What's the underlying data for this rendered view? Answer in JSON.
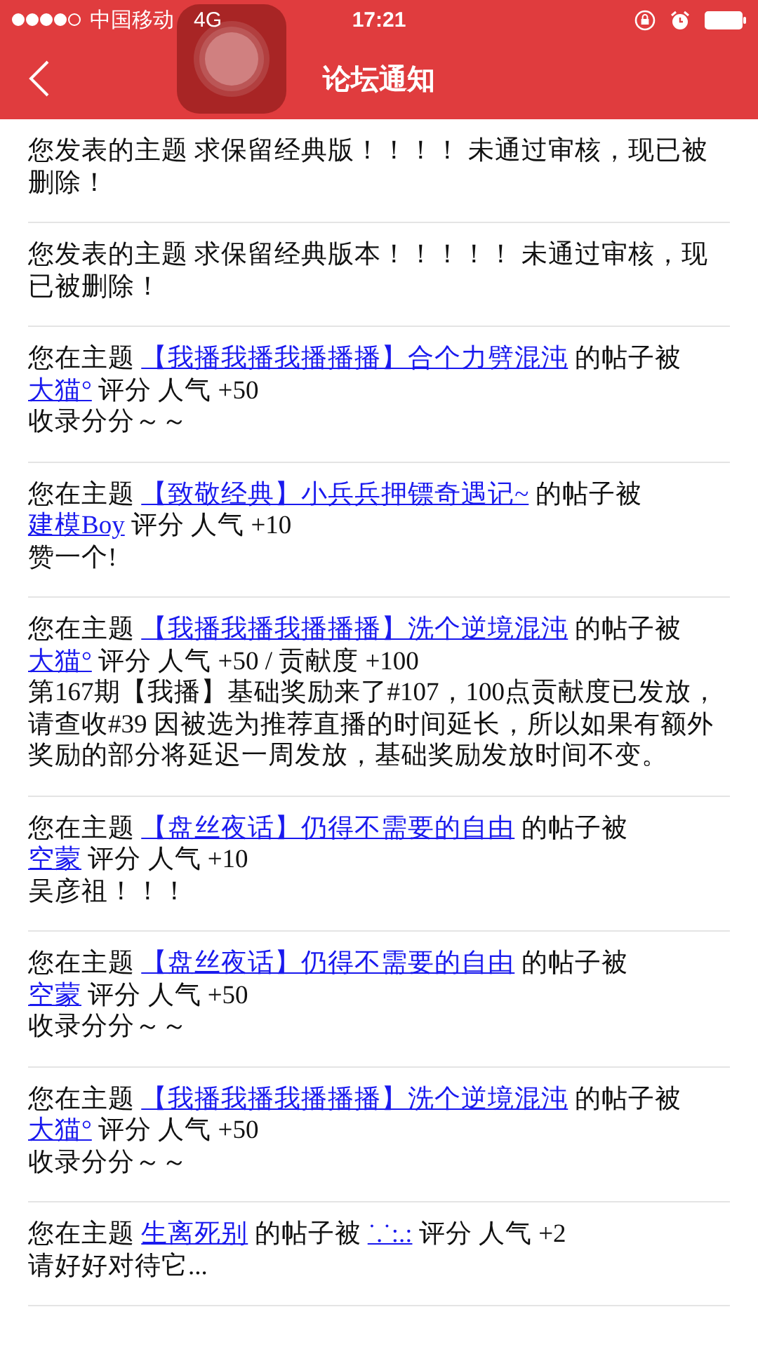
{
  "status_bar": {
    "carrier": "中国移动",
    "network": "4G",
    "time": "17:21"
  },
  "nav": {
    "title": "论坛通知"
  },
  "notices": [
    {
      "segments": [
        {
          "kind": "text",
          "text": "您发表的主题 求保留经典版！！！！ 未通过审核，现已被删除！"
        }
      ]
    },
    {
      "segments": [
        {
          "kind": "text",
          "text": "您发表的主题 求保留经典版本！！！！！ 未通过审核，现已被删除！"
        }
      ]
    },
    {
      "segments": [
        {
          "kind": "text",
          "text": "您在主题 "
        },
        {
          "kind": "link",
          "text": "【我播我播我播播播】合个力劈混沌"
        },
        {
          "kind": "text",
          "text": " 的帖子被 "
        },
        {
          "kind": "link",
          "text": "大猫°"
        },
        {
          "kind": "text",
          "text": " 评分 人气 +50"
        }
      ],
      "message": "收录分分～～"
    },
    {
      "segments": [
        {
          "kind": "text",
          "text": "您在主题 "
        },
        {
          "kind": "link",
          "text": "【致敬经典】小兵兵押镖奇遇记~"
        },
        {
          "kind": "text",
          "text": " 的帖子被 "
        },
        {
          "kind": "link",
          "text": "建模Boy"
        },
        {
          "kind": "text",
          "text": " 评分 人气 +10"
        }
      ],
      "message": "赞一个!"
    },
    {
      "segments": [
        {
          "kind": "text",
          "text": "您在主题 "
        },
        {
          "kind": "link",
          "text": "【我播我播我播播播】洗个逆境混沌"
        },
        {
          "kind": "text",
          "text": " 的帖子被 "
        },
        {
          "kind": "link",
          "text": "大猫°"
        },
        {
          "kind": "text",
          "text": " 评分 人气 +50 / 贡献度 +100"
        }
      ],
      "message": "第167期【我播】基础奖励来了#107，100点贡献度已发放，请查收#39 因被选为推荐直播的时间延长，所以如果有额外奖励的部分将延迟一周发放，基础奖励发放时间不变。"
    },
    {
      "segments": [
        {
          "kind": "text",
          "text": "您在主题 "
        },
        {
          "kind": "link",
          "text": "【盘丝夜话】仍得不需要的自由"
        },
        {
          "kind": "text",
          "text": " 的帖子被 "
        },
        {
          "kind": "link",
          "text": "空蒙"
        },
        {
          "kind": "text",
          "text": " 评分 人气 +10"
        }
      ],
      "message": "吴彦祖！！！"
    },
    {
      "segments": [
        {
          "kind": "text",
          "text": "您在主题 "
        },
        {
          "kind": "link",
          "text": "【盘丝夜话】仍得不需要的自由"
        },
        {
          "kind": "text",
          "text": " 的帖子被 "
        },
        {
          "kind": "link",
          "text": "空蒙"
        },
        {
          "kind": "text",
          "text": " 评分 人气 +50"
        }
      ],
      "message": "收录分分～～"
    },
    {
      "segments": [
        {
          "kind": "text",
          "text": "您在主题 "
        },
        {
          "kind": "link",
          "text": "【我播我播我播播播】洗个逆境混沌"
        },
        {
          "kind": "text",
          "text": " 的帖子被 "
        },
        {
          "kind": "link",
          "text": "大猫°"
        },
        {
          "kind": "text",
          "text": " 评分 人气 +50"
        }
      ],
      "message": "收录分分～～"
    },
    {
      "segments": [
        {
          "kind": "text",
          "text": "您在主题 "
        },
        {
          "kind": "link",
          "text": "生离死别"
        },
        {
          "kind": "text",
          "text": " 的帖子被 "
        },
        {
          "kind": "link",
          "text": "˙.˙:.:"
        },
        {
          "kind": "text",
          "text": " 评分 人气 +2"
        }
      ],
      "message": "请好好对待它..."
    }
  ]
}
